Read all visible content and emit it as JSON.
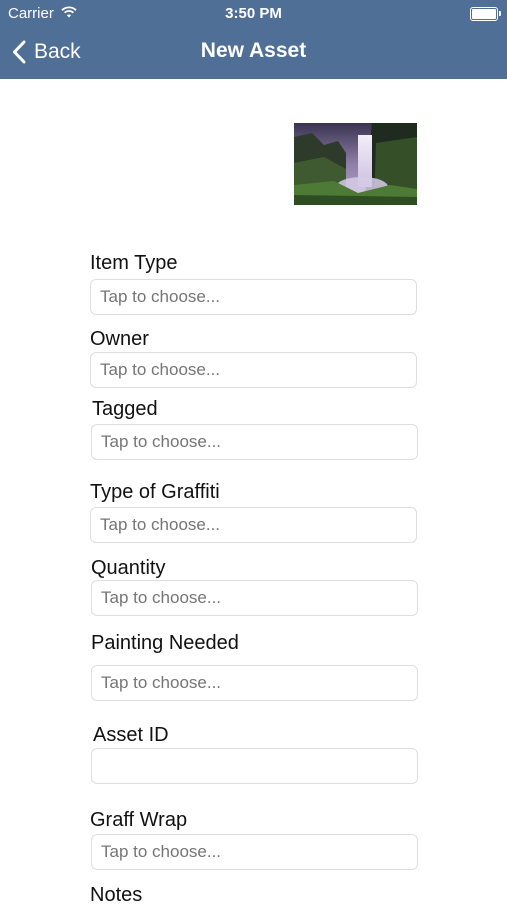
{
  "status_bar": {
    "carrier": "Carrier",
    "time": "3:50 PM"
  },
  "nav": {
    "back_label": "Back",
    "title": "New Asset"
  },
  "form": {
    "fields": [
      {
        "label": "Item Type",
        "placeholder": "Tap to choose..."
      },
      {
        "label": "Owner",
        "placeholder": "Tap to choose..."
      },
      {
        "label": "Tagged",
        "placeholder": "Tap to choose..."
      },
      {
        "label": "Type of Graffiti",
        "placeholder": "Tap to choose..."
      },
      {
        "label": "Quantity",
        "placeholder": "Tap to choose..."
      },
      {
        "label": "Painting Needed",
        "placeholder": "Tap to choose..."
      },
      {
        "label": "Asset ID",
        "placeholder": ""
      },
      {
        "label": "Graff Wrap",
        "placeholder": "Tap to choose..."
      },
      {
        "label": "Notes"
      }
    ]
  },
  "colors": {
    "nav_bar": "#4f6f96",
    "field_border": "#dedede",
    "placeholder": "#c4c4c4"
  }
}
